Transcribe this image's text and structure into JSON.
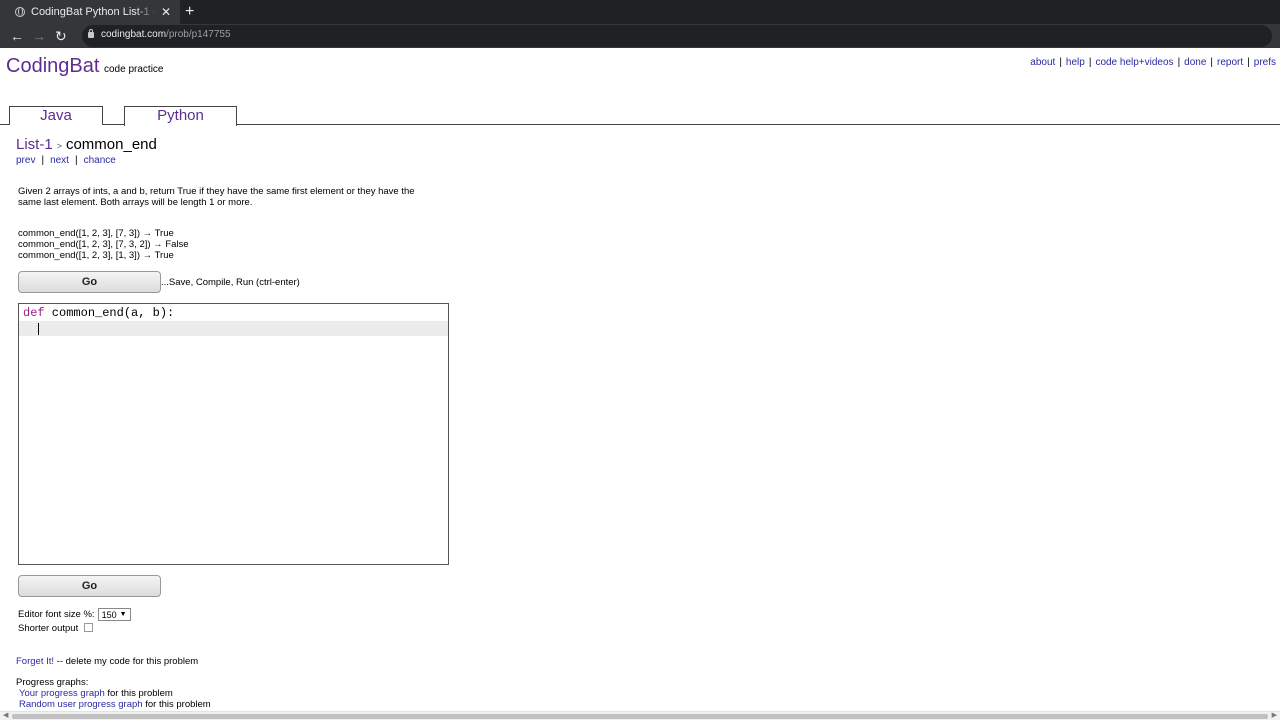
{
  "browser": {
    "tab_title": "CodingBat Python List-1 common_end",
    "tab_close": "✕",
    "new_tab": "+",
    "url_domain": "codingbat.com",
    "url_path": "/prob/p147755",
    "back": "←",
    "forward": "→",
    "reload": "↻"
  },
  "header": {
    "logo": "CodingBat",
    "tagline": "code practice",
    "links": [
      "about",
      "help",
      "code help+videos",
      "done",
      "report",
      "prefs"
    ],
    "sep": "|"
  },
  "lang_tabs": {
    "java": "Java",
    "python": "Python",
    "active": "Python"
  },
  "breadcrumb": {
    "list": "List-1",
    "arrow": ">",
    "problem": "common_end"
  },
  "subnav": {
    "prev": "prev",
    "next": "next",
    "chance": "chance",
    "sep": "|"
  },
  "description": "Given 2 arrays of ints, a and b, return True if they have the same first element or they have the same last element. Both arrays will be length 1 or more.",
  "examples": [
    "common_end([1, 2, 3], [7, 3]) → True",
    "common_end([1, 2, 3], [7, 3, 2]) → False",
    "common_end([1, 2, 3], [1, 3]) → True"
  ],
  "go_button": "Go",
  "go_hint": "...Save, Compile, Run (ctrl-enter)",
  "editor": {
    "keyword": "def",
    "signature": " common_end(a, b):"
  },
  "settings": {
    "font_size_label": "Editor font size %:",
    "font_size_value": "150",
    "shorter_label": "Shorter output"
  },
  "forget": {
    "link": "Forget It!",
    "text": " -- delete my code for this problem"
  },
  "progress": {
    "label": "Progress graphs:",
    "your_link": "Your progress graph",
    "your_suffix": " for this problem",
    "random_link": "Random user progress graph",
    "random_suffix": " for this problem"
  },
  "colors": {
    "brand": "#5e2d91",
    "link": "#2a2aa6",
    "keyword": "#a11a8f"
  }
}
